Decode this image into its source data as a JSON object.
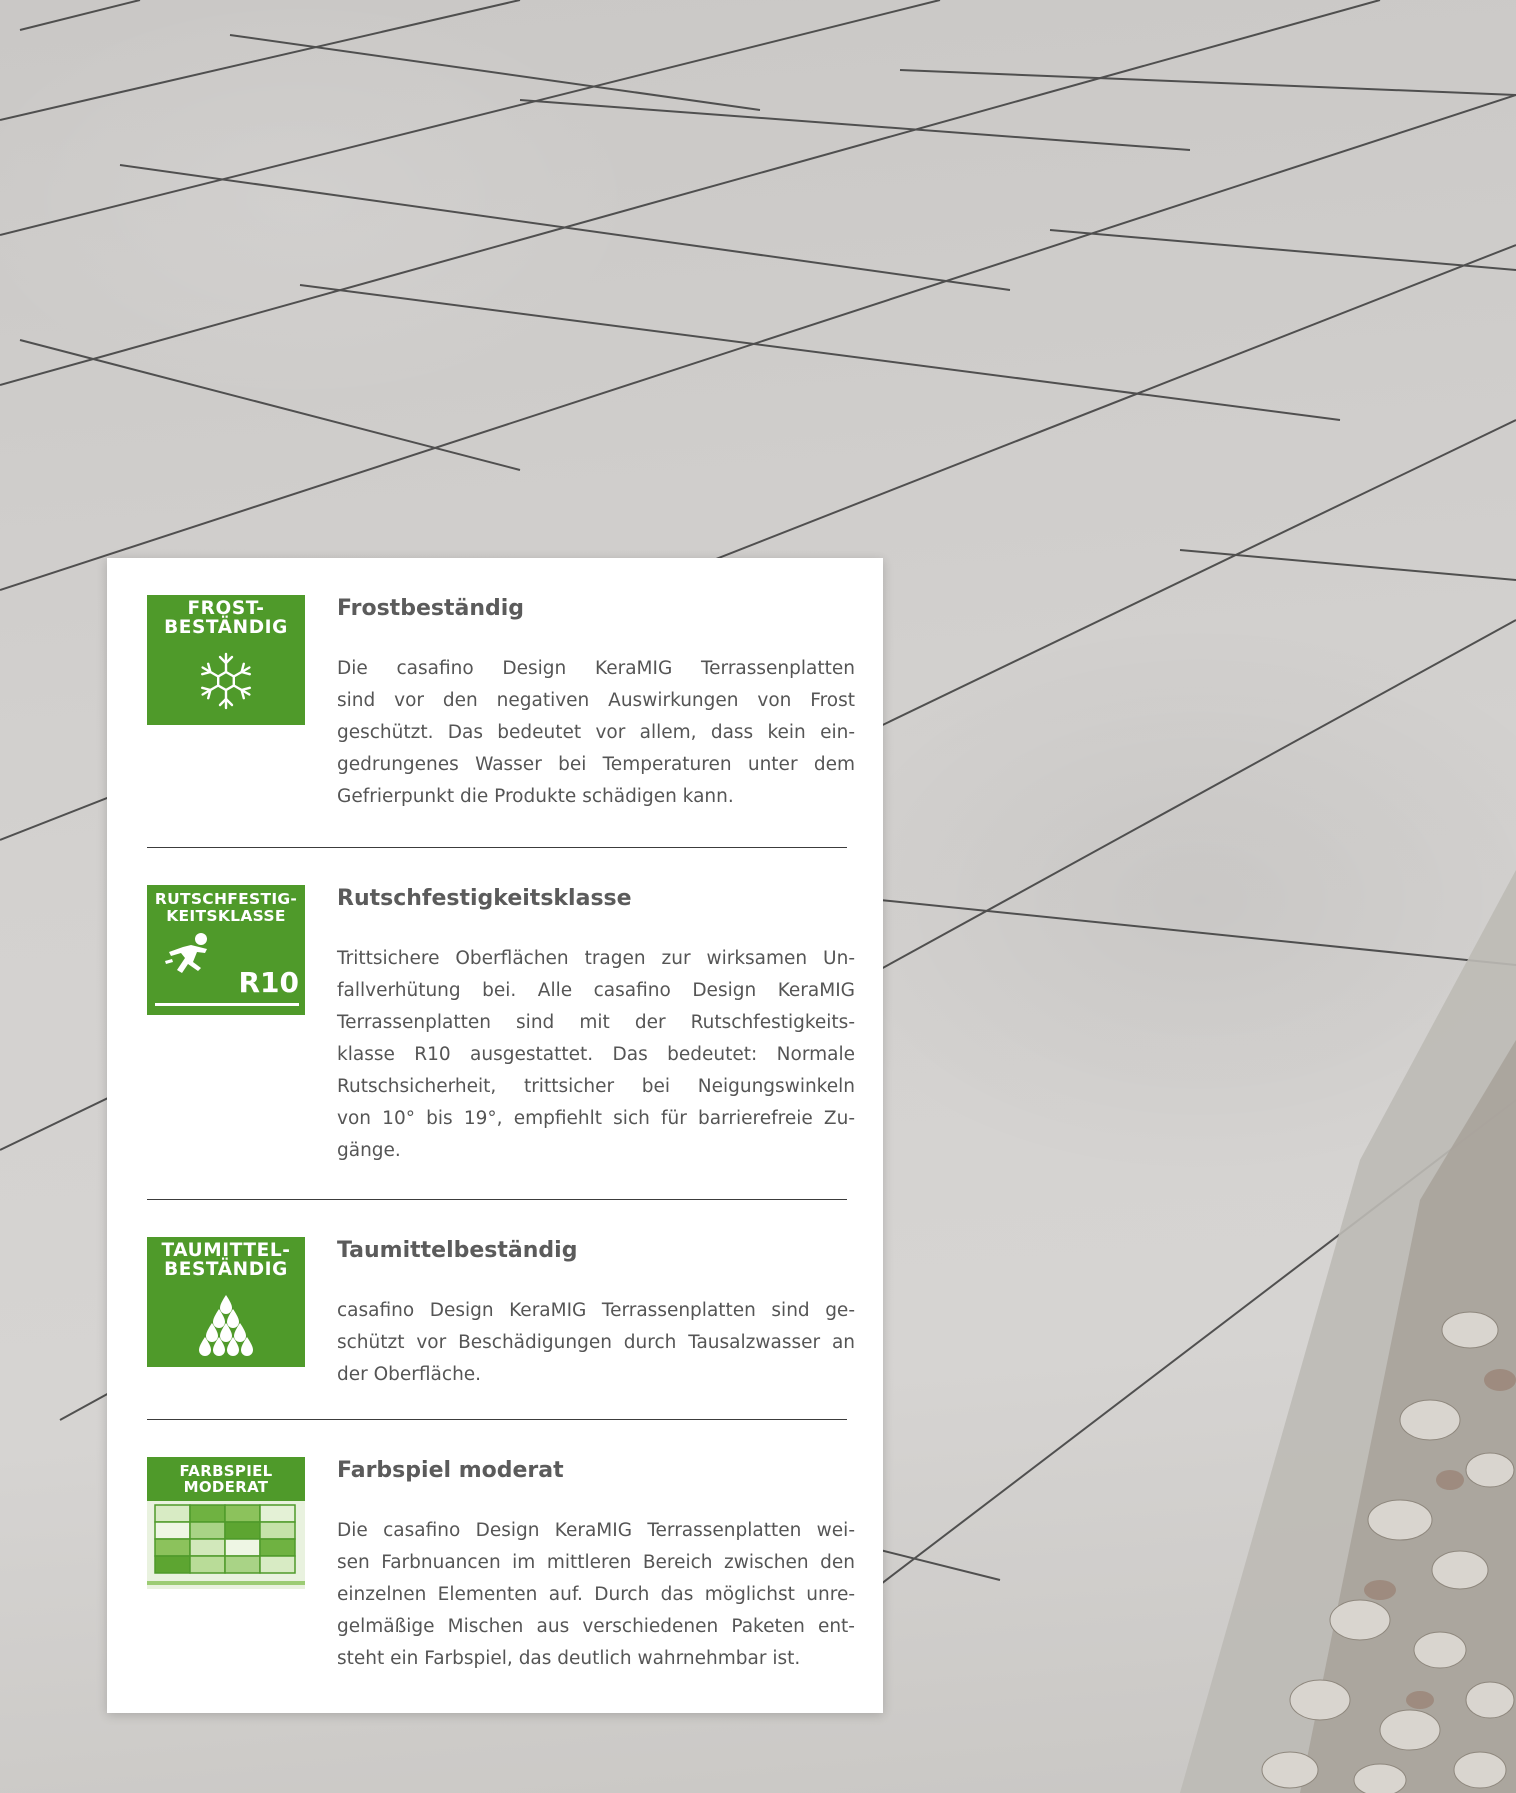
{
  "features": [
    {
      "badge_label": "FROST-\nBESTÄNDIG",
      "badge_icon": "snowflake-icon",
      "title": "Frostbeständig",
      "lines": [
        "Die casafino Design KeraMIG Terrassenplatten",
        "sind vor den negativen Auswirkungen von Frost",
        "geschützt. Das bedeutet vor allem, dass kein ein-",
        "gedrungenes Wasser bei Temperaturen unter dem",
        "Gefrierpunkt die Produkte schädigen kann."
      ]
    },
    {
      "badge_label": "RUTSCHFESTIG-\nKEITSKLASSE",
      "badge_icon": "slipping-person-icon",
      "badge_value": "R10",
      "title": "Rutschfestigkeitsklasse",
      "lines": [
        "Trittsichere Oberflächen tragen zur wirksamen Un-",
        "fallverhütung bei. Alle casafino Design KeraMIG",
        "Terrassenplatten sind mit der Rutschfestigkeits-",
        "klasse R10 ausgestattet. Das bedeutet: Normale",
        "Rutschsicherheit, trittsicher bei Neigungswinkeln",
        "von 10° bis 19°, empfiehlt sich für barrierefreie Zu-",
        "gänge."
      ]
    },
    {
      "badge_label": "TAUMITTEL-\nBESTÄNDIG",
      "badge_icon": "water-drops-icon",
      "title": "Taumittelbeständig",
      "lines": [
        "casafino Design KeraMIG Terrassenplatten sind ge-",
        "schützt vor Beschädigungen durch Tausalzwasser an",
        "der Oberfläche."
      ]
    },
    {
      "badge_label": "FARBSPIEL\nMODERAT",
      "badge_icon": "color-grid-icon",
      "title": "Farbspiel moderat",
      "lines": [
        "Die casafino Design KeraMIG Terrassenplatten wei-",
        "sen Farbnuancen im mittleren Bereich zwischen den",
        "einzelnen Elementen auf. Durch das möglichst unre-",
        "gelmäßige Mischen aus verschiedenen Paketen ent-",
        "steht ein Farbspiel, das deutlich wahrnehmbar ist."
      ]
    }
  ],
  "colors": {
    "badge_green": "#4f9a2a",
    "title_gray": "#5b5b5b",
    "text_gray": "#555555"
  }
}
